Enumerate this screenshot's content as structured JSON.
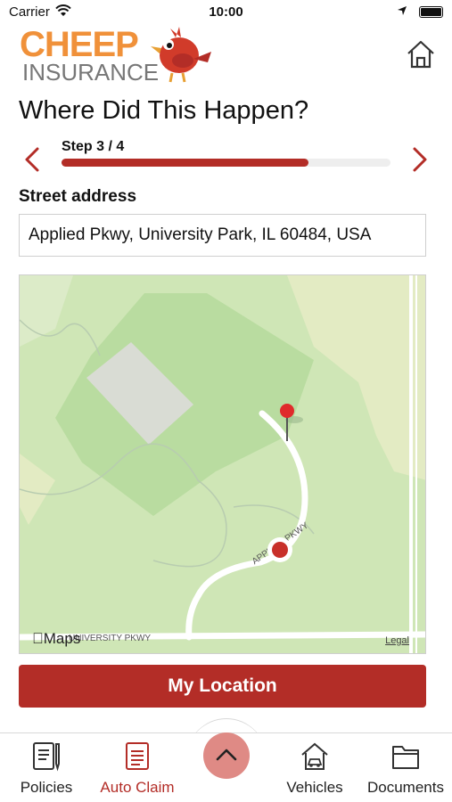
{
  "status": {
    "carrier": "Carrier",
    "time": "10:00"
  },
  "brand": {
    "line1": "CHEEP",
    "line2": "INSURANCE",
    "color": "#f0913a"
  },
  "header": {
    "home_icon": "home-icon"
  },
  "title": "Where Did This Happen?",
  "stepper": {
    "label": "Step 3 / 4",
    "progress": 0.75,
    "prev_icon": "chevron-left-icon",
    "next_icon": "chevron-right-icon"
  },
  "address": {
    "label": "Street address",
    "value": "Applied Pkwy, University Park, IL 60484, USA"
  },
  "map": {
    "brand": "Maps",
    "legal": "Legal",
    "road_label_1": "APPLIED PKWY",
    "road_label_2": "UNIVERSITY PKWY"
  },
  "actions": {
    "my_location": "My Location"
  },
  "tabs": [
    {
      "label": "Policies",
      "icon": "policies-icon"
    },
    {
      "label": "Auto Claim",
      "icon": "auto-claim-icon",
      "active": true
    },
    {
      "label": "Vehicles",
      "icon": "vehicles-icon"
    },
    {
      "label": "Documents",
      "icon": "documents-icon"
    }
  ],
  "center_button_icon": "chevron-up-icon",
  "colors": {
    "accent": "#b32d27",
    "center_button": "#df8a85",
    "map_green": "#cfe6b6"
  }
}
